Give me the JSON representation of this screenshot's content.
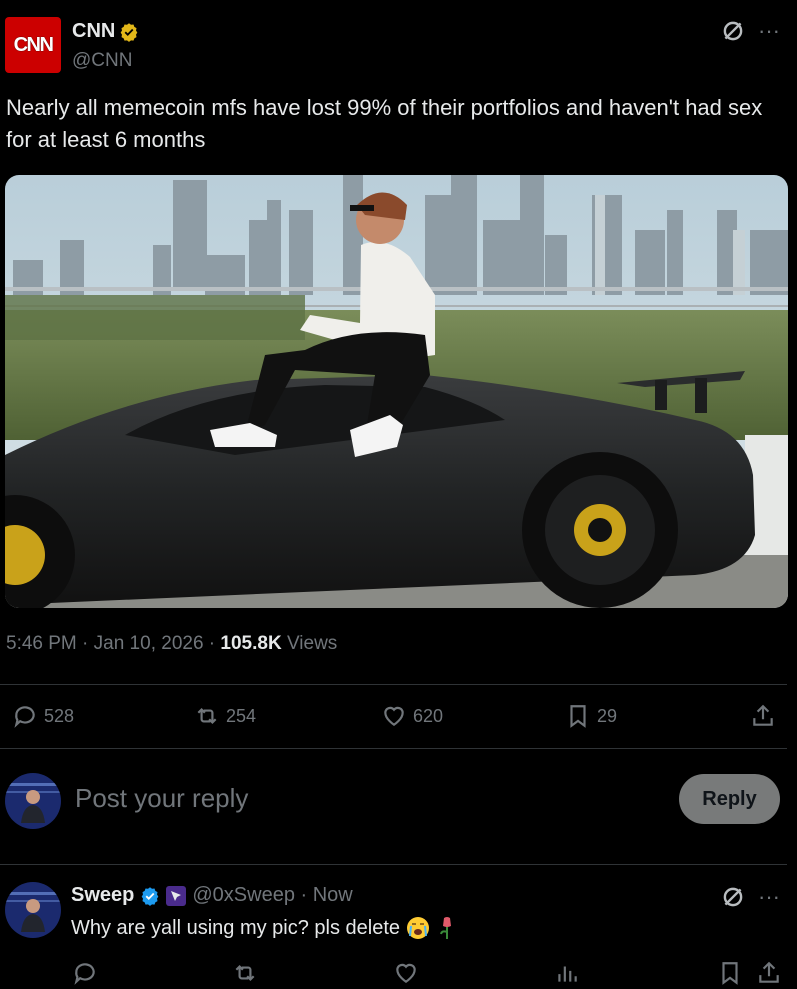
{
  "post": {
    "author_name": "CNN",
    "author_handle": "@CNN",
    "avatar_text": "CNN",
    "text": "Nearly all memecoin mfs have lost 99% of their portfolios and haven't had sex for at least 6 months",
    "time": "5:46 PM · Jan 10, 2026 · ",
    "views_count": "105.8K",
    "views_label": "Views",
    "replies": "528",
    "reposts": "254",
    "likes": "620",
    "bookmarks": "29"
  },
  "composer": {
    "placeholder": "Post your reply",
    "reply_label": "Reply"
  },
  "comment": {
    "author_name": "Sweep",
    "author_handle": "@0xSweep · Now",
    "text": "Why are yall using my pic? pls delete"
  },
  "colors": {
    "background": "#000000",
    "text": "#e7e9ea",
    "muted": "#71767b",
    "verified_gold": "#e2b719",
    "verified_blue": "#1d9bf0",
    "cnn_red": "#cc0000"
  }
}
